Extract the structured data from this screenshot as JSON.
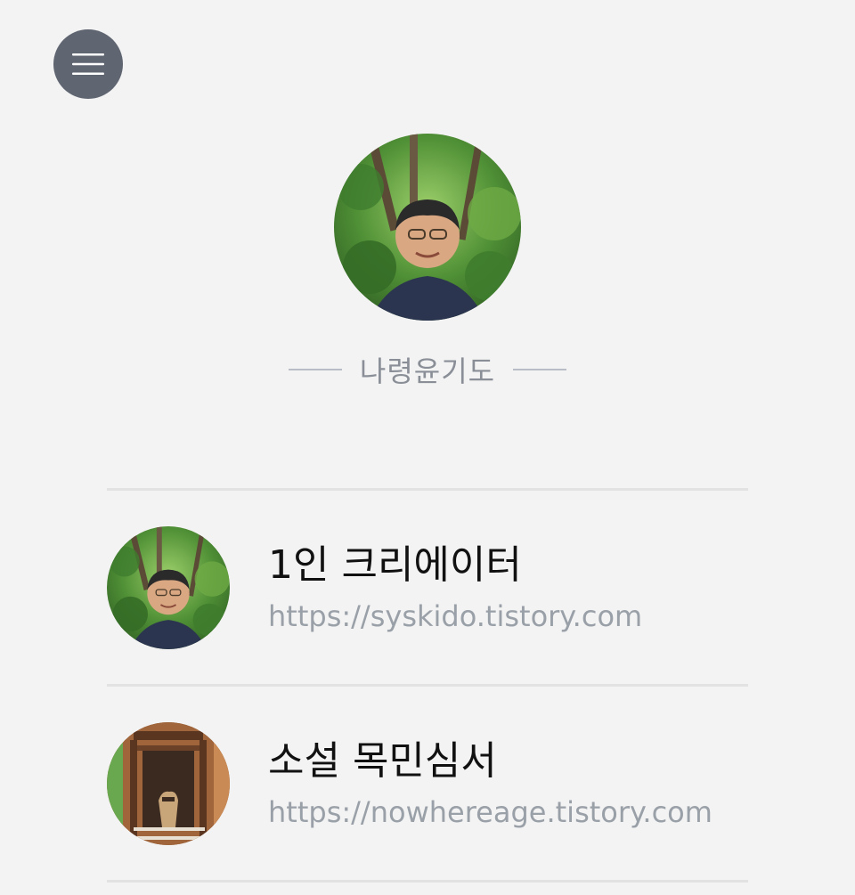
{
  "header": {
    "menu_icon": "hamburger-menu-icon"
  },
  "profile": {
    "avatar_icon": "profile-photo",
    "blog_name": "나령윤기도"
  },
  "links": [
    {
      "title": "1인 크리에이터",
      "url": "https://syskido.tistory.com",
      "thumbnail": "profile-photo"
    },
    {
      "title": "소설 목민심서",
      "url": "https://nowhereage.tistory.com",
      "thumbnail": "stable-horse-photo"
    }
  ],
  "colors": {
    "background": "#f3f3f3",
    "menu_button": "#5f6571",
    "title_text": "#111111",
    "url_text": "#9aa0a8",
    "divider": "#e2e2e2"
  }
}
